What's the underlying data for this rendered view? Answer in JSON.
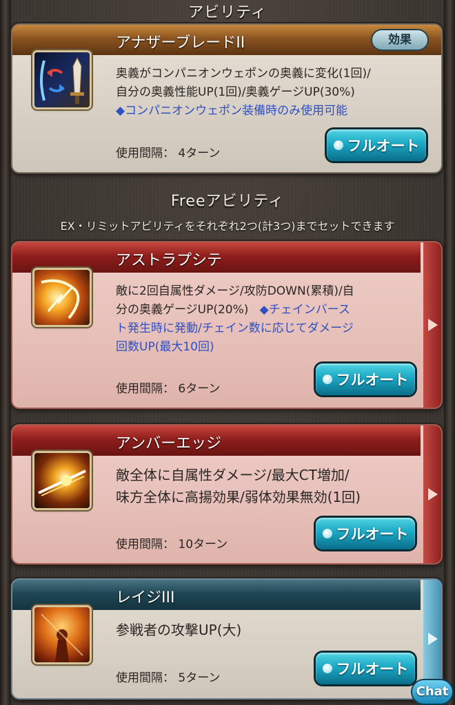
{
  "sections": {
    "ability_title": "アビリティ",
    "free_title": "Freeアビリティ",
    "free_subtitle": "EX・リミットアビリティをそれぞれ2つ(計3つ)までセットできます"
  },
  "effect_label": "効果",
  "chat_label": "Chat",
  "abilities": [
    {
      "name": "アナザーブレードII",
      "desc_lines": [
        "奥義がコンパニオンウェポンの奥義に変化(1回)/",
        "自分の奥義性能UP(1回)/奥義ゲージUP(30%)"
      ],
      "note": "◆コンパニオンウェポン装備時のみ使用可能",
      "interval": "使用間隔： 4ターン",
      "button": "フルオート",
      "icon": "sword-swap-icon"
    },
    {
      "name": "アストラプシテ",
      "desc_lines": [
        "敵に2回自属性ダメージ/攻防DOWN(累積)/自",
        "分の奥義ゲージUP(20%)"
      ],
      "note_lines": [
        "◆チェインバース",
        "ト発生時に発動/チェイン数に応じてダメージ",
        "回数UP(最大10回)"
      ],
      "interval": "使用間隔： 6ターン",
      "button": "フルオート",
      "icon": "lightning-slash-icon"
    },
    {
      "name": "アンバーエッジ",
      "desc_lines": [
        "敵全体に自属性ダメージ/最大CT増加/",
        "味方全体に高揚効果/弱体効果無効(1回)"
      ],
      "interval": "使用間隔： 10ターン",
      "button": "フルオート",
      "icon": "amber-edge-icon"
    },
    {
      "name": "レイジIII",
      "desc_lines": [
        "参戦者の攻撃UP(大)"
      ],
      "interval": "使用間隔： 5ターン",
      "button": "フルオート",
      "icon": "rage-icon"
    }
  ]
}
